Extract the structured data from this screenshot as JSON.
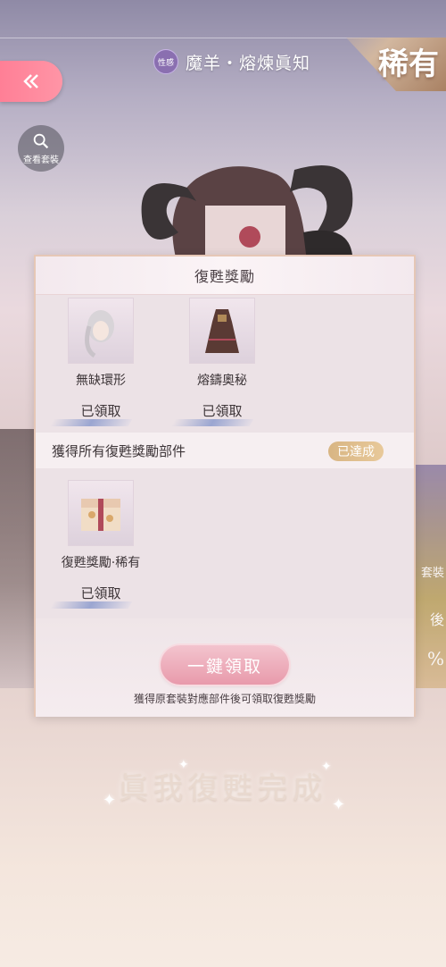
{
  "header": {
    "tag_label": "性感",
    "title": "魔羊・熔煉眞知",
    "rarity_label": "稀有"
  },
  "buttons": {
    "view_outfit_label": "查看套裝"
  },
  "side_decor": {
    "right_texts": [
      "套裝",
      "後",
      "%"
    ]
  },
  "panel": {
    "title": "復甦獎勵",
    "items": [
      {
        "name": "無缺環形",
        "status": "已領取"
      },
      {
        "name": "熔鑄奧秘",
        "status": "已領取"
      }
    ],
    "section": {
      "title": "獲得所有復甦獎勵部件",
      "badge": "已達成",
      "items": [
        {
          "name": "復甦獎勵·稀有",
          "status": "已領取"
        }
      ]
    },
    "claim_all_label": "一鍵領取",
    "hint": "獲得原套裝對應部件後可領取復甦獎勵"
  },
  "completion_text": "眞我復甦完成",
  "colors": {
    "accent_pink": "#ff7f96",
    "gold_badge": "#d8b583"
  }
}
